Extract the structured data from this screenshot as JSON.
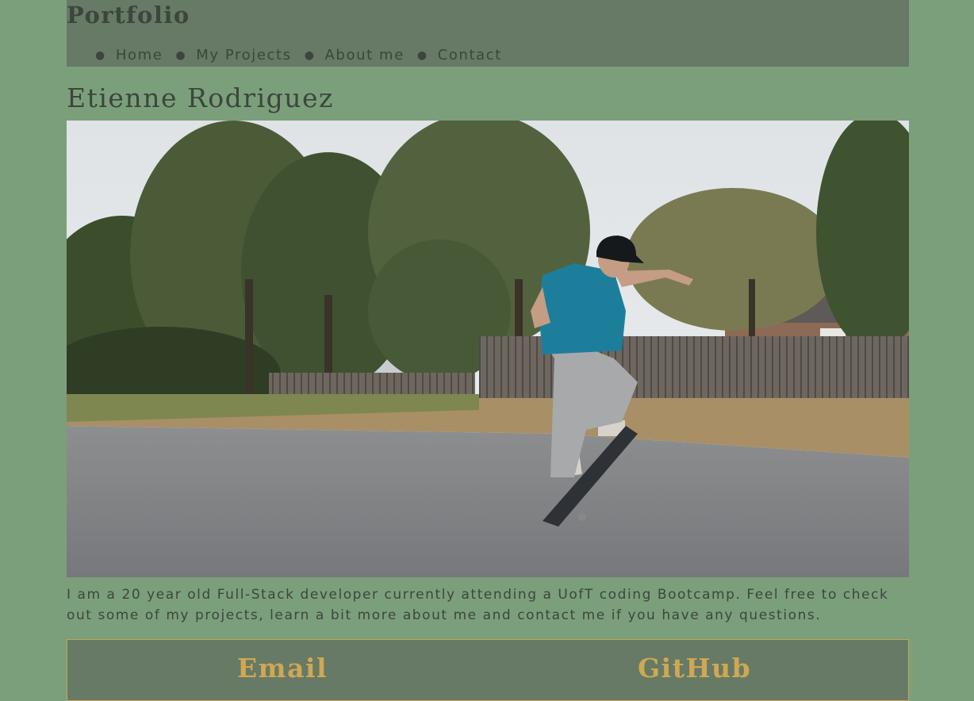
{
  "header": {
    "title": "Portfolio",
    "nav": [
      {
        "label": "Home"
      },
      {
        "label": "My Projects"
      },
      {
        "label": "About me"
      },
      {
        "label": "Contact"
      }
    ]
  },
  "main": {
    "name": "Etienne Rodriguez",
    "bio": "I am a 20 year old Full-Stack developer currently attending a UofT coding Bootcamp. Feel free to check out some of my projects, learn a bit more about me and contact me if you have any questions."
  },
  "contact": {
    "email_label": "Email",
    "github_label": "GitHub"
  },
  "colors": {
    "page_background": "#7b9f7b",
    "header_background": "#667a66",
    "text": "#3c463c",
    "accent": "#d0a752"
  }
}
